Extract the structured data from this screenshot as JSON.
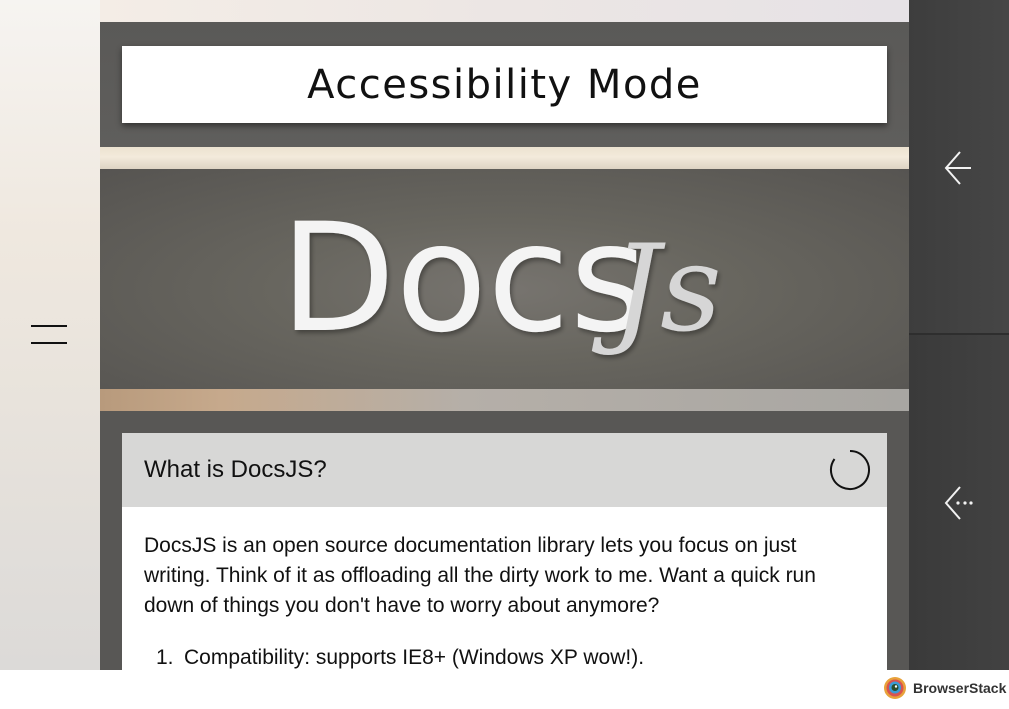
{
  "page": {
    "title": "Accessibility Mode",
    "logo_text": "DocsJs"
  },
  "menu": {
    "icon": "hamburger-menu-icon"
  },
  "article": {
    "heading": "What is DocsJS?",
    "paragraph": "DocsJS is an open source documentation library lets you focus on just writing. Think of it as offloading all the dirty work to me. Want a quick run down of things you don't have to worry about anymore?",
    "list_items": [
      {
        "number": "1.",
        "text": "Compatibility: supports IE8+ (Windows XP wow!)."
      }
    ]
  },
  "nav": {
    "back_icon": "arrow-left-icon",
    "back_more_icon": "arrow-left-dotted-icon"
  },
  "footer": {
    "brand": "BrowserStack"
  },
  "colors": {
    "title_bg": "#ffffff",
    "card_header_bg": "#d7d7d6",
    "right_panel": "#404040",
    "main_bg": "#575654"
  }
}
